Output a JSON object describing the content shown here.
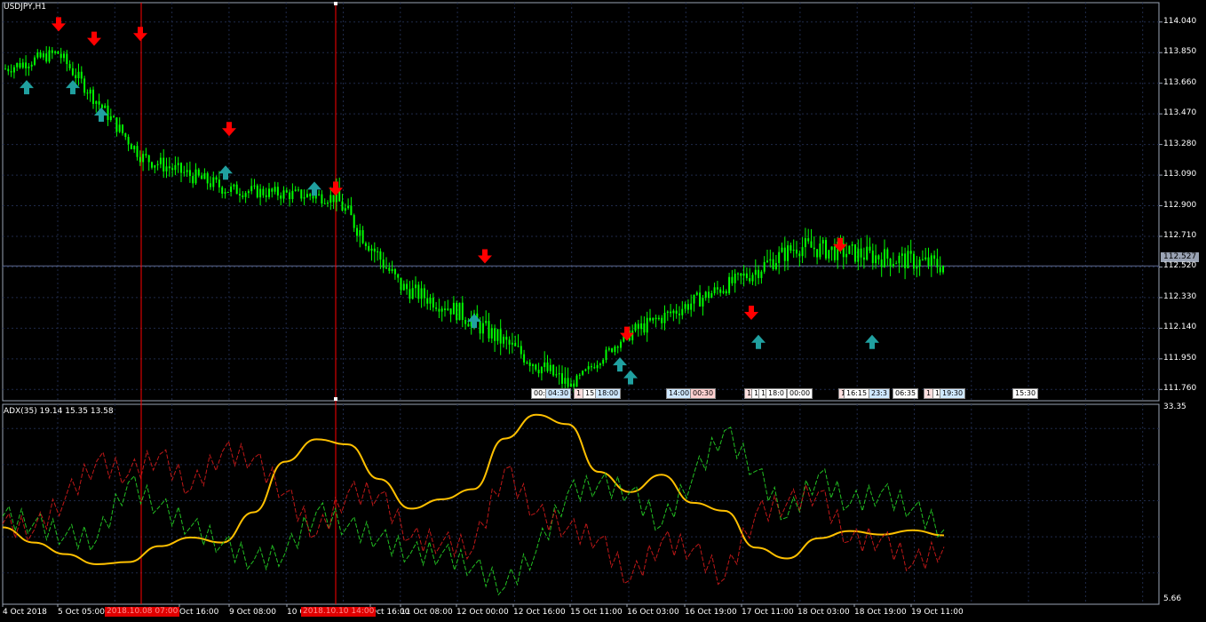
{
  "symbol_title": "USDJPY,H1",
  "current_price": "112.527",
  "price_axis": {
    "ticks": [
      "114.040",
      "113.850",
      "113.660",
      "113.470",
      "113.280",
      "113.090",
      "112.900",
      "112.710",
      "112.520",
      "112.330",
      "112.140",
      "111.950",
      "111.760"
    ],
    "range": [
      111.69,
      114.16
    ]
  },
  "indicator": {
    "title": "ADX(35) 19.14 15.35 13.58",
    "adx": "19.14",
    "plus_di": "15.35",
    "minus_di": "13.58",
    "scale_max": "33.35",
    "scale_min": "5.66",
    "range": [
      5.66,
      33.35
    ]
  },
  "time_axis": {
    "ticks": [
      "4 Oct 2018",
      "5 Oct 05:00",
      "Oct 16:00",
      "9 Oct 08:00",
      "10 O",
      "Oct 16:00",
      "11 Oct 08:00",
      "12 Oct 00:00",
      "12 Oct 16:00",
      "15 Oct 11:00",
      "16 Oct 03:00",
      "16 Oct 19:00",
      "17 Oct 11:00",
      "18 Oct 03:00",
      "18 Oct 19:00",
      "19 Oct 11:00"
    ],
    "highlighted": [
      "2018.10.08 07:00",
      "2018.10.10 14:00"
    ]
  },
  "event_labels": [
    "00:",
    "04:30",
    "1",
    "15",
    "18:00",
    "14:00",
    "00:30",
    "1",
    "1",
    "1",
    "18:0",
    "00:00",
    "1",
    "16:15",
    "23:3",
    "06:35",
    "1",
    "1",
    "19:30",
    "15:30"
  ],
  "colors": {
    "background": "#000000",
    "grid": "#1f2a4a",
    "candles": "#00ff00",
    "down_arrow": "#ff0000",
    "up_arrow": "#20a0a0",
    "adx_line": "#ffc000",
    "plus_di": "#22c022",
    "minus_di": "#c01818",
    "vline": "#ff0000",
    "price_line": "#5f6a8f"
  },
  "chart_data": [
    {
      "type": "candlestick",
      "title": "USDJPY,H1",
      "x": [
        "4 Oct",
        "5 Oct",
        "8 Oct",
        "9 Oct",
        "10 Oct",
        "11 Oct",
        "12 Oct",
        "15 Oct",
        "16 Oct",
        "17 Oct",
        "18 Oct",
        "19 Oct"
      ],
      "close": [
        113.75,
        113.85,
        113.2,
        113.0,
        112.95,
        112.4,
        112.25,
        111.78,
        112.1,
        112.45,
        112.65,
        112.53
      ],
      "high": [
        114.05,
        114.05,
        113.4,
        113.37,
        113.25,
        112.6,
        112.58,
        111.95,
        112.3,
        112.72,
        112.65,
        112.6
      ],
      "low": [
        113.6,
        113.55,
        112.85,
        112.9,
        112.55,
        112.0,
        111.9,
        111.7,
        111.75,
        112.05,
        111.95,
        112.3
      ],
      "ylim": [
        111.69,
        114.16
      ],
      "markers": {
        "down": [
          114.07,
          113.98,
          114.01,
          113.42,
          113.05,
          112.63,
          112.15,
          112.28,
          112.7
        ],
        "up": [
          113.63,
          113.63,
          113.46,
          113.1,
          113.0,
          112.18,
          111.91,
          111.83,
          112.05,
          112.05
        ]
      }
    },
    {
      "type": "line",
      "title": "ADX(35) 19.14 15.35 13.58",
      "series": [
        {
          "name": "ADX",
          "values": [
            16.3,
            14.2,
            12.6,
            11.2,
            11.5,
            13.7,
            14.9,
            14.2,
            18.4,
            25.4,
            28.5,
            27.8,
            23.0,
            18.9,
            20.2,
            21.6,
            28.6,
            31.9,
            30.6,
            24.0,
            21.2,
            23.6,
            19.7,
            18.6,
            13.5,
            12.0,
            14.8,
            15.8,
            15.3,
            15.9,
            15.2
          ]
        },
        {
          "name": "+DI",
          "values": [
            17.8,
            16.9,
            15.2,
            14.6,
            22.5,
            19.2,
            16.4,
            14.0,
            11.7,
            12.7,
            18.5,
            16.5,
            14.8,
            12.7,
            12.7,
            10.9,
            8.0,
            13.0,
            21.0,
            22.4,
            21.3,
            16.6,
            23.3,
            29.7,
            24.1,
            17.7,
            23.6,
            19.5,
            21.2,
            18.9,
            16.0
          ]
        },
        {
          "name": "-DI",
          "values": [
            16.8,
            15.9,
            20.4,
            25.5,
            23.6,
            26.4,
            21.6,
            26.8,
            25.9,
            21.1,
            15.3,
            21.1,
            20.9,
            14.8,
            14.2,
            13.4,
            24.4,
            18.3,
            16.2,
            14.7,
            9.0,
            14.4,
            13.3,
            9.2,
            18.2,
            19.7,
            21.2,
            14.4,
            14.8,
            11.2,
            13.6
          ]
        }
      ],
      "ylim": [
        5.66,
        33.35
      ]
    }
  ]
}
